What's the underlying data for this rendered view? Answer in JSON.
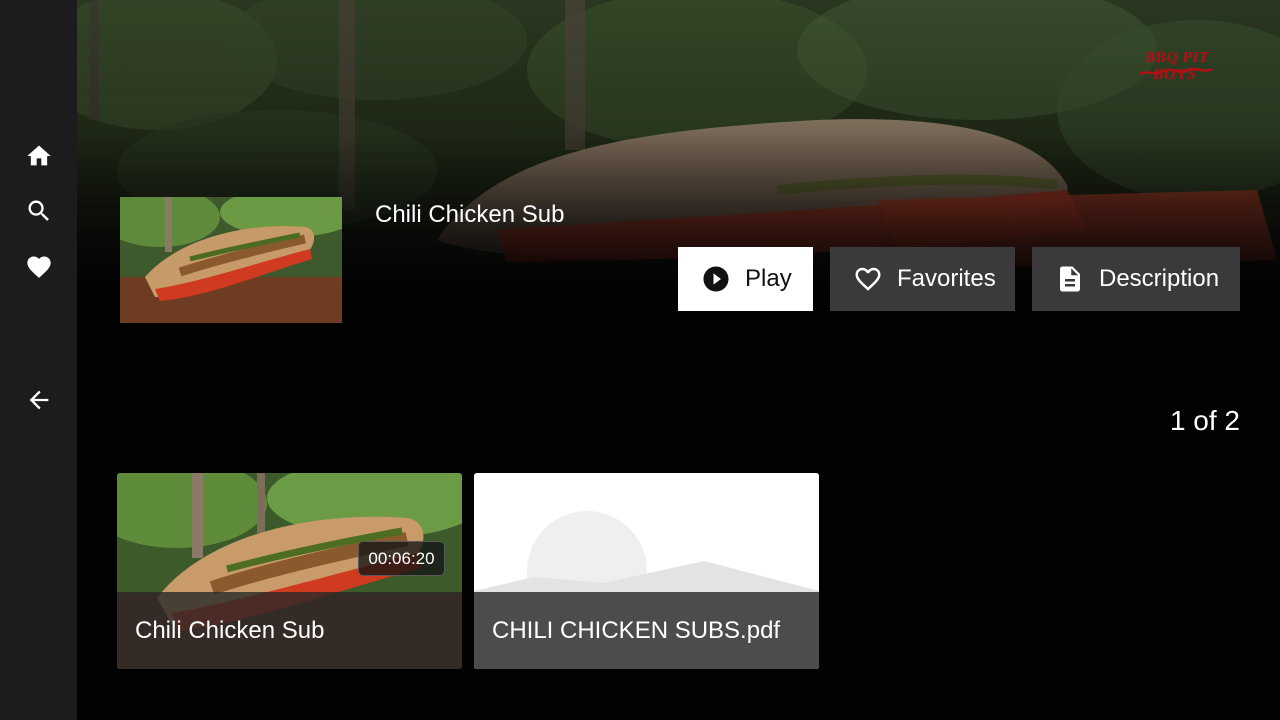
{
  "nav": {
    "items": [
      {
        "icon": "home-icon"
      },
      {
        "icon": "search-icon"
      },
      {
        "icon": "heart-icon"
      },
      {
        "icon": "back-arrow-icon"
      }
    ]
  },
  "brand": {
    "logo_text": "BBQ PIT BOYS",
    "color": "#b40f12"
  },
  "detail": {
    "title": "Chili Chicken Sub",
    "actions": {
      "play": "Play",
      "favorites": "Favorites",
      "description": "Description"
    }
  },
  "pager": {
    "text": "1 of 2"
  },
  "cards": [
    {
      "title": "Chili Chicken Sub",
      "duration": "00:06:20",
      "kind": "video"
    },
    {
      "title": "CHILI CHICKEN SUBS.pdf",
      "kind": "document"
    }
  ],
  "colors": {
    "background": "#030203",
    "nav": "#1c1c1c",
    "button_secondary": "#3b393b",
    "button_primary": "#ffffff"
  }
}
